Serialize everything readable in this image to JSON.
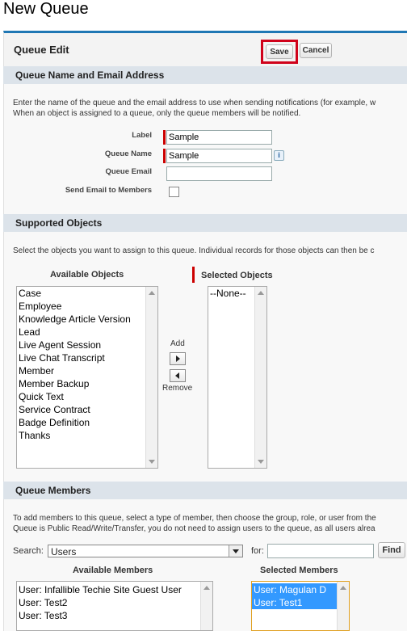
{
  "page": {
    "title": "New Queue"
  },
  "panel": {
    "title": "Queue Edit",
    "save_label": "Save",
    "cancel_label": "Cancel"
  },
  "section_name": {
    "title": "Queue Name and Email Address",
    "note_line1": "Enter the name of the queue and the email address to use when sending notifications (for example, w",
    "note_line2": "When an object is assigned to a queue, only the queue members will be notified.",
    "label_label": "Label",
    "label_value": "Sample",
    "queue_name_label": "Queue Name",
    "queue_name_value": "Sample",
    "queue_email_label": "Queue Email",
    "queue_email_value": "",
    "send_email_label": "Send Email to Members",
    "send_email_checked": false
  },
  "section_objects": {
    "title": "Supported Objects",
    "note": "Select the objects you want to assign to this queue. Individual records for those objects can then be c",
    "available_header": "Available Objects",
    "selected_header": "Selected Objects",
    "add_label": "Add",
    "remove_label": "Remove",
    "available": [
      "Case",
      "Employee",
      "Knowledge Article Version",
      "Lead",
      "Live Agent Session",
      "Live Chat Transcript",
      "Member",
      "Member Backup",
      "Quick Text",
      "Service Contract",
      "Badge Definition",
      "Thanks"
    ],
    "selected": [
      "--None--"
    ]
  },
  "section_members": {
    "title": "Queue Members",
    "note_line1": "To add members to this queue, select a type of member, then choose the group, role, or user from the",
    "note_line2": "Queue is Public Read/Write/Transfer, you do not need to assign users to the queue, as all users alrea",
    "search_label": "Search:",
    "search_value": "Users",
    "for_label": "for:",
    "for_value": "",
    "find_label": "Find",
    "available_header": "Available Members",
    "selected_header": "Selected Members",
    "available": [
      "User: Infallible Techie Site Guest User",
      "User: Test2",
      "User: Test3"
    ],
    "selected": [
      "User: Magulan D",
      "User: Test1"
    ]
  },
  "colors": {
    "accent": "#1f77b4",
    "required": "#cc0000",
    "highlight": "#d0021b",
    "selection": "#3399ff"
  }
}
